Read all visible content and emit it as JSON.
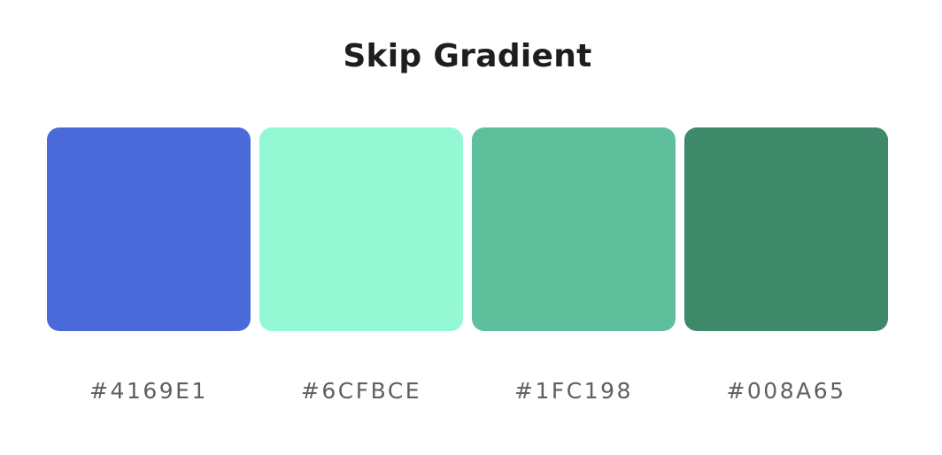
{
  "title": "Skip Gradient",
  "swatches": [
    {
      "label": "#4169E1",
      "display_color": "#4a6ada"
    },
    {
      "label": "#6CFBCE",
      "display_color": "#95f8d4"
    },
    {
      "label": "#1FC198",
      "display_color": "#5dbf9c"
    },
    {
      "label": "#008A65",
      "display_color": "#3d896a"
    }
  ]
}
